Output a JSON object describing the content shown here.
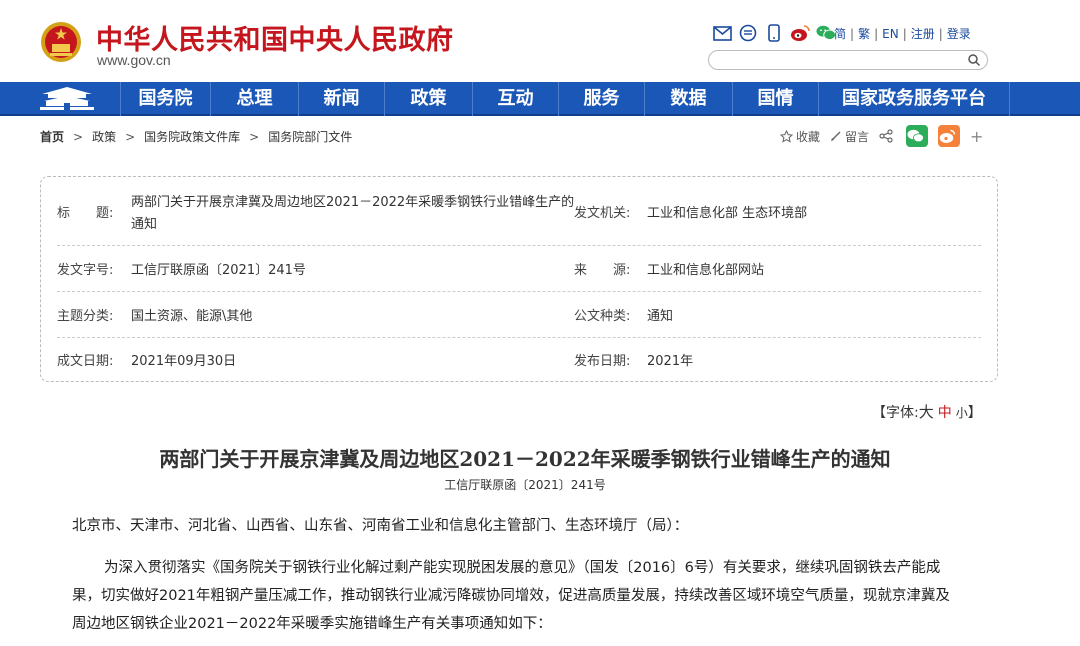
{
  "header": {
    "site_title": "中华人民共和国中央人民政府",
    "site_url": "www.gov.cn",
    "icons": [
      "mail-icon",
      "rss-icon",
      "mobile-icon",
      "weibo-icon",
      "wechat-icon"
    ],
    "links": [
      "简",
      "繁",
      "EN",
      "注册",
      "登录"
    ],
    "search_placeholder": ""
  },
  "nav": {
    "items": [
      "国务院",
      "总理",
      "新闻",
      "政策",
      "互动",
      "服务",
      "数据",
      "国情",
      "国家政务服务平台"
    ]
  },
  "breadcrumb": [
    "首页",
    "政策",
    "国务院政策文件库",
    "国务院部门文件"
  ],
  "tools": {
    "favorite": "收藏",
    "comment": "留言",
    "plus": "+"
  },
  "info": {
    "title_label": "标　　题:",
    "title_value_1": "两部门关于开展京津冀及周边地区2021－2022年采暖季钢铁行业错峰生产的",
    "title_value_2": "通知",
    "issuer_label": "发文机关:",
    "issuer_value": "工业和信息化部 生态环境部",
    "docno_label": "发文字号:",
    "docno_value": "工信厅联原函〔2021〕241号",
    "source_label": "来　　源:",
    "source_value": "工业和信息化部网站",
    "topic_label": "主题分类:",
    "topic_value": "国土资源、能源\\其他",
    "doctype_label": "公文种类:",
    "doctype_value": "通知",
    "created_label": "成文日期:",
    "created_value": "2021年09月30日",
    "published_label": "发布日期:",
    "published_value": "2021年"
  },
  "fontsize": {
    "prefix": "【字体:",
    "big": "大",
    "mid": "中",
    "small": "小",
    "suffix": "】"
  },
  "article": {
    "title": "两部门关于开展京津冀及周边地区2021－2022年采暖季钢铁行业错峰生产的通知",
    "docno": "工信厅联原函〔2021〕241号",
    "salutation": "北京市、天津市、河北省、山西省、山东省、河南省工业和信息化主管部门、生态环境厅（局）：",
    "p1_line1": "为深入贯彻落实《国务院关于钢铁行业化解过剩产能实现脱困发展的意见》（国发〔2016〕6号）有关要求，继续巩固钢铁去产能成",
    "p1_line2": "果，切实做好2021年粗钢产量压减工作，推动钢铁行业减污降碳协同增效，促进高质量发展，持续改善区域环境空气质量，现就京津冀及",
    "p1_line3": "周边地区钢铁企业2021－2022年采暖季实施错峰生产有关事项通知如下："
  },
  "colors": {
    "brand_red": "#c4161c",
    "nav_blue": "#1a57b6",
    "link_blue": "#1a4a9e",
    "wechat_green": "#2bad5a",
    "weibo_orange": "#f5813b"
  }
}
